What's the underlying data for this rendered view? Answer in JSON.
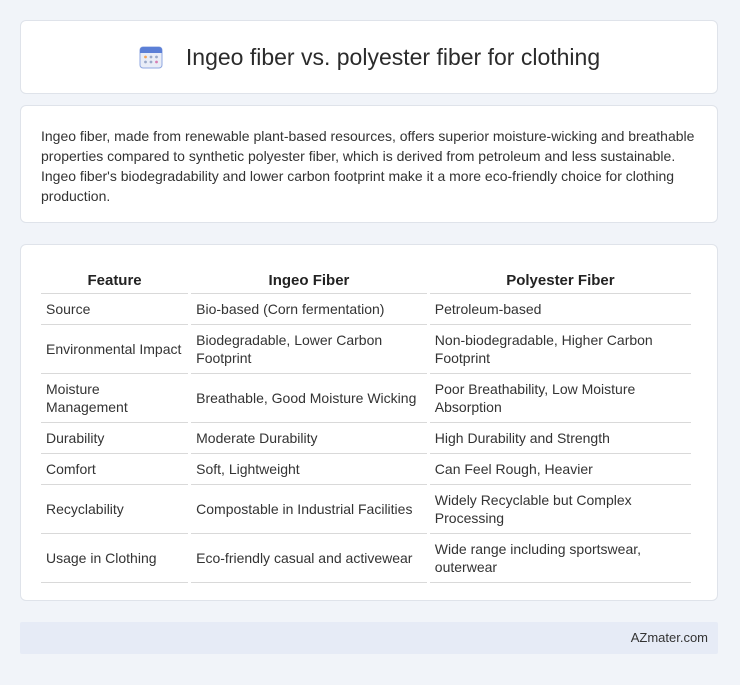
{
  "header": {
    "icon": "calendar-icon",
    "title": "Ingeo fiber vs. polyester fiber for clothing"
  },
  "intro": {
    "text": "Ingeo fiber, made from renewable plant-based resources, offers superior moisture-wicking and breathable properties compared to synthetic polyester fiber, which is derived from petroleum and less sustainable. Ingeo fiber's biodegradability and lower carbon footprint make it a more eco-friendly choice for clothing production."
  },
  "table": {
    "headers": [
      "Feature",
      "Ingeo Fiber",
      "Polyester Fiber"
    ],
    "rows": [
      [
        "Source",
        "Bio-based (Corn fermentation)",
        "Petroleum-based"
      ],
      [
        "Environmental Impact",
        "Biodegradable, Lower Carbon Footprint",
        "Non-biodegradable, Higher Carbon Footprint"
      ],
      [
        "Moisture Management",
        "Breathable, Good Moisture Wicking",
        "Poor Breathability, Low Moisture Absorption"
      ],
      [
        "Durability",
        "Moderate Durability",
        "High Durability and Strength"
      ],
      [
        "Comfort",
        "Soft, Lightweight",
        "Can Feel Rough, Heavier"
      ],
      [
        "Recyclability",
        "Compostable in Industrial Facilities",
        "Widely Recyclable but Complex Processing"
      ],
      [
        "Usage in Clothing",
        "Eco-friendly casual and activewear",
        "Wide range including sportswear, outerwear"
      ]
    ]
  },
  "footer": {
    "brand": "AZmater.com"
  },
  "colors": {
    "page_background": "#f1f4f9",
    "card_background": "#ffffff",
    "footer_background": "#e6ebf6",
    "icon_accent": "#5b7fd6"
  }
}
